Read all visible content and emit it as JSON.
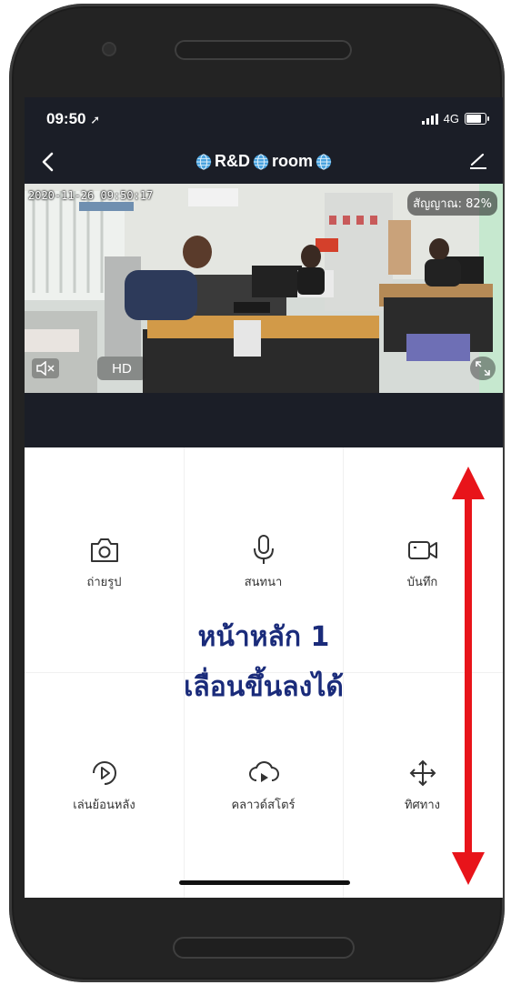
{
  "status_bar": {
    "time": "09:50",
    "location_glyph": "➚",
    "network": "4G"
  },
  "header": {
    "title_part1": "R&D",
    "title_part2": "room"
  },
  "video": {
    "timestamp": "2020-11-26 09:50:17",
    "signal_label": "สัญญาณ: 82%",
    "quality": "HD"
  },
  "controls": [
    {
      "icon": "camera-icon",
      "label": "ถ่ายรูป"
    },
    {
      "icon": "microphone-icon",
      "label": "สนทนา"
    },
    {
      "icon": "video-record-icon",
      "label": "บันทึก"
    },
    {
      "icon": "playback-icon",
      "label": "เล่นย้อนหลัง"
    },
    {
      "icon": "cloud-icon",
      "label": "คลาวด์สโตร์"
    },
    {
      "icon": "direction-icon",
      "label": "ทิศทาง"
    }
  ],
  "annotation": {
    "line1": "หน้าหลัก 1",
    "line2": "เลื่อนขึ้นลงได้",
    "color": "#1a2b7a",
    "arrow_color": "#e8141a"
  },
  "theme": {
    "topbar_bg": "#1b1e27"
  }
}
